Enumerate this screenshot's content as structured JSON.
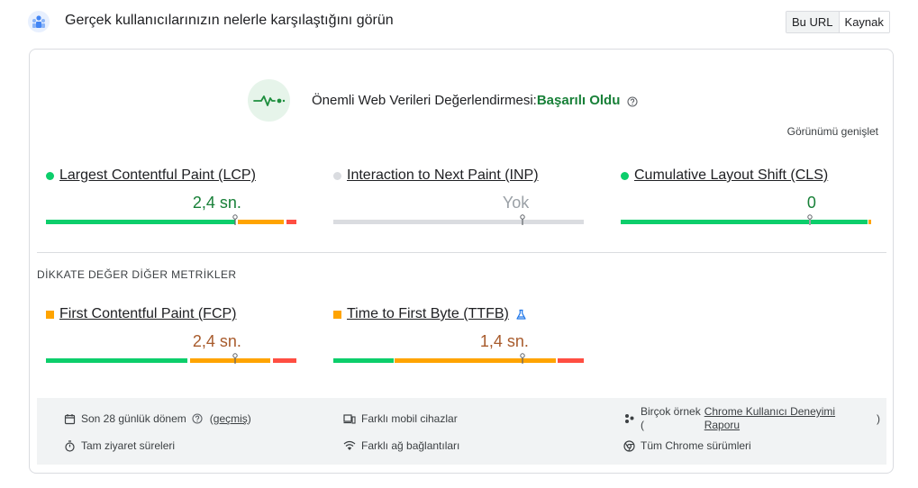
{
  "header": {
    "title": "Gerçek kullanıcılarınızın nelerle karşılaştığını görün",
    "toggle": {
      "this_url": "Bu URL",
      "origin": "Kaynak"
    }
  },
  "assessment": {
    "label": "Önemli Web Verileri Değerlendirmesi:",
    "status": "Başarılı Oldu",
    "expand_view": "Görünümü genişlet"
  },
  "metrics": [
    {
      "name": "Largest Contentful Paint (LCP)",
      "value": "2,4 sn.",
      "status_color": "#0cce6b",
      "value_color": "#188038",
      "marker_percent": 75.5,
      "segments": [
        {
          "start": 0,
          "width": 75.4,
          "color": "#0cce6b"
        },
        {
          "start": 76.5,
          "width": 18.5,
          "color": "#ffa400"
        },
        {
          "start": 96,
          "width": 4,
          "color": "#ff4e42"
        }
      ]
    },
    {
      "name": "Interaction to Next Paint (INP)",
      "value": "Yok",
      "status_color": "#dadce0",
      "value_color": "#9aa0a6",
      "marker_percent": 75.5,
      "segments": [
        {
          "start": 0,
          "width": 100,
          "color": "#dadce0"
        }
      ]
    },
    {
      "name": "Cumulative Layout Shift (CLS)",
      "value": "0",
      "status_color": "#0cce6b",
      "value_color": "#188038",
      "marker_percent": 75.5,
      "segments": [
        {
          "start": 0,
          "width": 75,
          "color": "#0cce6b"
        },
        {
          "start": 76,
          "width": 22.5,
          "color": "#0cce6b"
        },
        {
          "start": 99,
          "width": 1,
          "color": "#ffa400"
        }
      ]
    }
  ],
  "other_metrics": {
    "heading": "DİKKATE DEĞER DİĞER METRİKLER",
    "items": [
      {
        "name": "First Contentful Paint (FCP)",
        "value": "2,4 sn.",
        "status_color": "#ffa400",
        "value_color": "#a85b2c",
        "marker_percent": 75.5,
        "lab": false,
        "segments": [
          {
            "start": 0,
            "width": 56.5,
            "color": "#0cce6b"
          },
          {
            "start": 57.5,
            "width": 32,
            "color": "#ffa400"
          },
          {
            "start": 90.5,
            "width": 9.5,
            "color": "#ff4e42"
          }
        ]
      },
      {
        "name": "Time to First Byte (TTFB)",
        "value": "1,4 sn.",
        "status_color": "#ffa400",
        "value_color": "#a85b2c",
        "marker_percent": 75.5,
        "lab": true,
        "segments": [
          {
            "start": 0,
            "width": 24,
            "color": "#0cce6b"
          },
          {
            "start": 24.5,
            "width": 64.5,
            "color": "#ffa400"
          },
          {
            "start": 89.5,
            "width": 10.5,
            "color": "#ff4e42"
          }
        ]
      }
    ]
  },
  "footer": {
    "period": "Son 28 günlük dönem",
    "history_open": "(",
    "history_link": "geçmiş",
    "history_close": ")",
    "visit_durations": "Tam ziyaret süreleri",
    "devices": "Farklı mobil cihazlar",
    "networks": "Farklı ağ bağlantıları",
    "samples_prefix": "Birçok örnek",
    "samples_open": "(",
    "crux_link_line1": "Chrome Kullanıcı Deneyimi",
    "crux_link_line2": "Raporu",
    "samples_close": ")",
    "chrome_versions": "Tüm Chrome sürümleri"
  }
}
